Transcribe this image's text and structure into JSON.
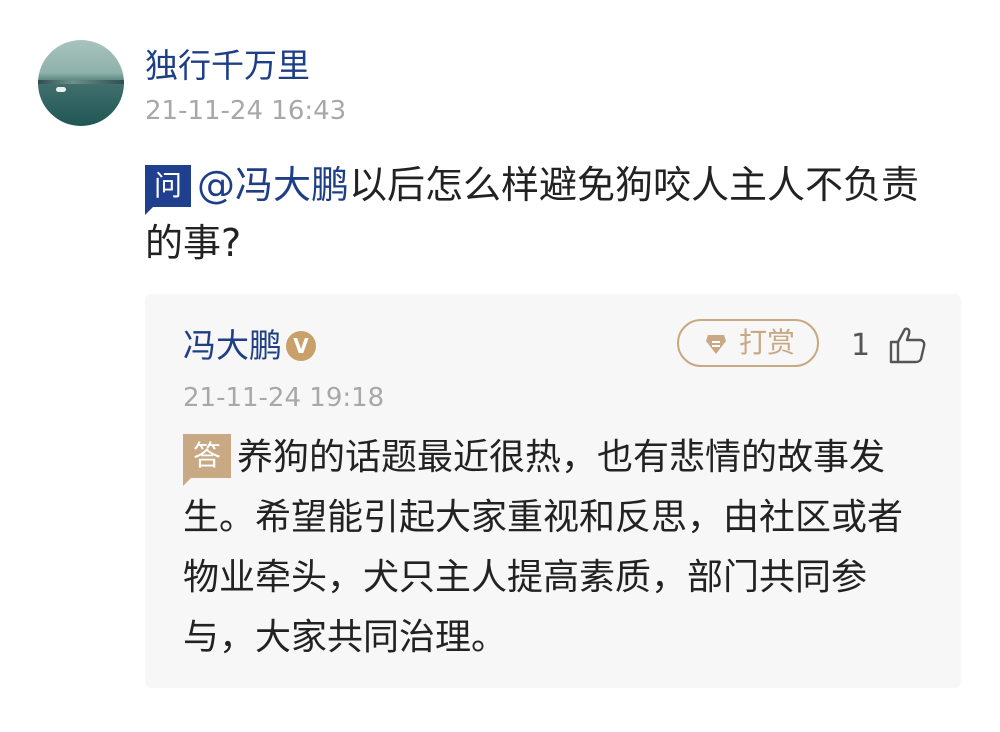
{
  "question_post": {
    "author": "独行千万里",
    "timestamp": "21-11-24 16:43",
    "badge": "问",
    "mention": "@冯大鹏",
    "text": "以后怎么样避免狗咬人主人不负责的事?"
  },
  "reply": {
    "author": "冯大鹏",
    "verified_badge": "V",
    "tip_button_label": "打赏",
    "like_count": "1",
    "timestamp": "21-11-24 19:18",
    "badge": "答",
    "text": "养狗的话题最近很热，也有悲情的故事发生。希望能引起大家重视和反思，由社区或者物业牵头，犬只主人提高素质，部门共同参与，大家共同治理。"
  },
  "colors": {
    "link_blue": "#1e3f86",
    "question_badge": "#203f8e",
    "gold": "#c9a983",
    "timestamp_gray": "#a8a8a8"
  },
  "icons": [
    "avatar-image",
    "verified-v-icon",
    "reward-gem-icon",
    "thumbs-up-icon"
  ]
}
